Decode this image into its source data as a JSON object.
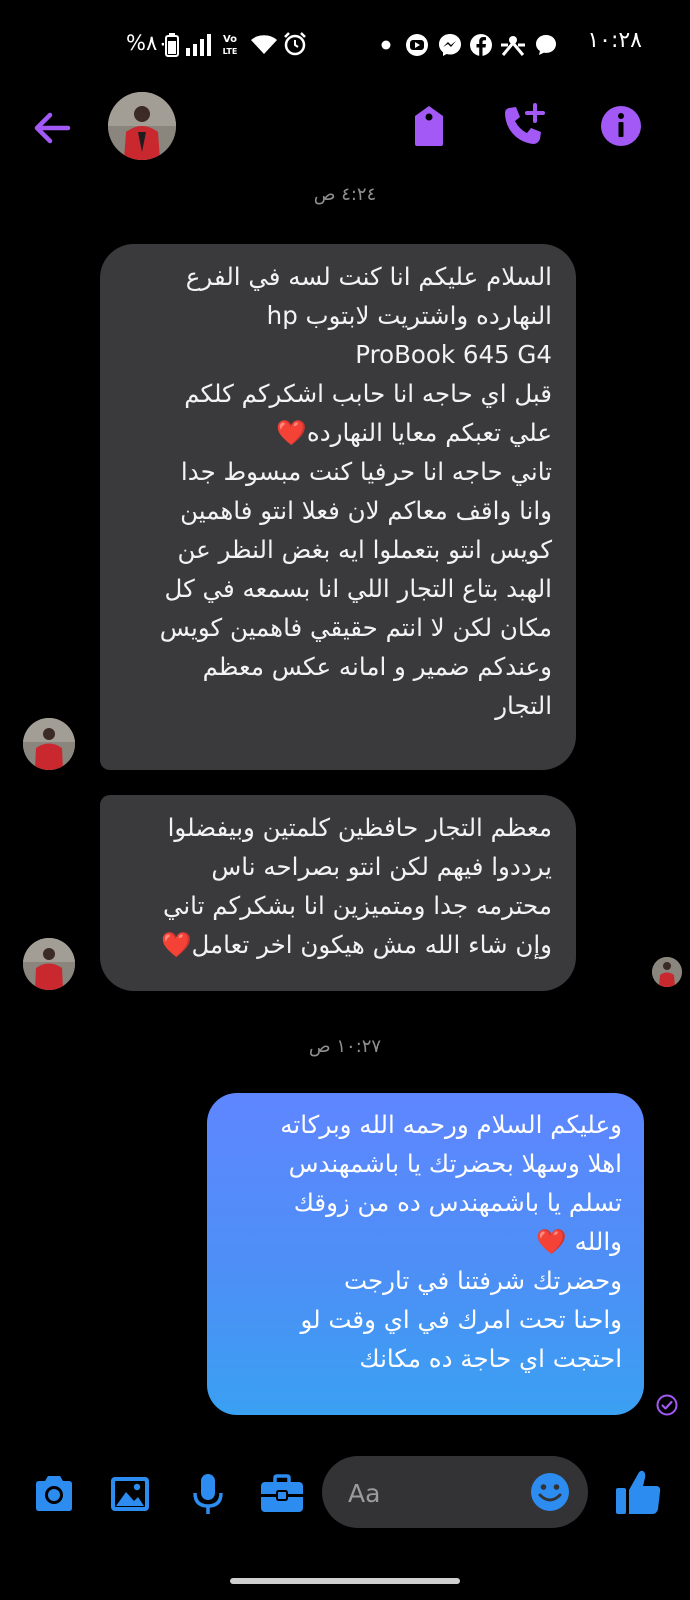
{
  "status_bar": {
    "time": "١٠:٢٨",
    "battery_text": "%٨٠",
    "network_label": "Vo LTE",
    "icons": [
      "battery-icon",
      "signal-icon",
      "volte-icon",
      "wifi-icon",
      "alarm-icon",
      "dot-icon",
      "youtube-icon",
      "messenger-icon",
      "facebook-icon",
      "network-icon",
      "chat-icon"
    ]
  },
  "header": {
    "back_icon": "arrow-left-icon",
    "actions": [
      "tag-icon",
      "add-call-icon",
      "info-icon"
    ],
    "accent": "#a259f5"
  },
  "messages": [
    {
      "type": "timestamp",
      "text": "٤:٢٤ ص"
    },
    {
      "type": "incoming",
      "text": "السلام عليكم انا كنت لسه في الفرع\nالنهارده واشتريت لابتوب hp\nProBook 645 G4\nقبل اي حاجه انا حابب اشكركم كلكم\nعلي تعبكم معايا النهارده❤️\n تاني حاجه انا حرفيا كنت مبسوط جدا\nوانا واقف معاكم لان فعلا انتو فاهمين\nكويس انتو بتعملوا ايه بغض النظر عن\nالهبد بتاع التجار اللي انا بسمعه في كل\nمكان لكن لا انتم حقيقي فاهمين كويس\nوعندكم ضمير و امانه عكس معظم\nالتجار"
    },
    {
      "type": "incoming",
      "text": "معظم التجار حافظين كلمتين وبيفضلوا\nيرددوا فيهم لكن انتو بصراحه ناس\nمحترمه جدا ومتميزين انا بشكركم تاني\nوإن شاء الله مش هيكون اخر تعامل❤️"
    },
    {
      "type": "timestamp",
      "text": "١٠:٢٧ ص"
    },
    {
      "type": "outgoing",
      "text": "وعليكم السلام ورحمه الله وبركاته\nاهلا وسهلا بحضرتك يا باشمهندس\nتسلم يا باشمهندس ده من زوقك\nوالله ❤️\n وحضرتك شرفتنا في تارجت\nواحنا  تحت امرك في اي وقت لو\nاحتجت اي حاجة ده مكانك"
    }
  ],
  "composer": {
    "placeholder": "Aa",
    "buttons": [
      "camera-icon",
      "image-icon",
      "microphone-icon",
      "briefcase-icon"
    ],
    "emoji_icon": "smiley-icon",
    "like_icon": "thumbs-up-icon",
    "accent": "#2d8cf0"
  }
}
